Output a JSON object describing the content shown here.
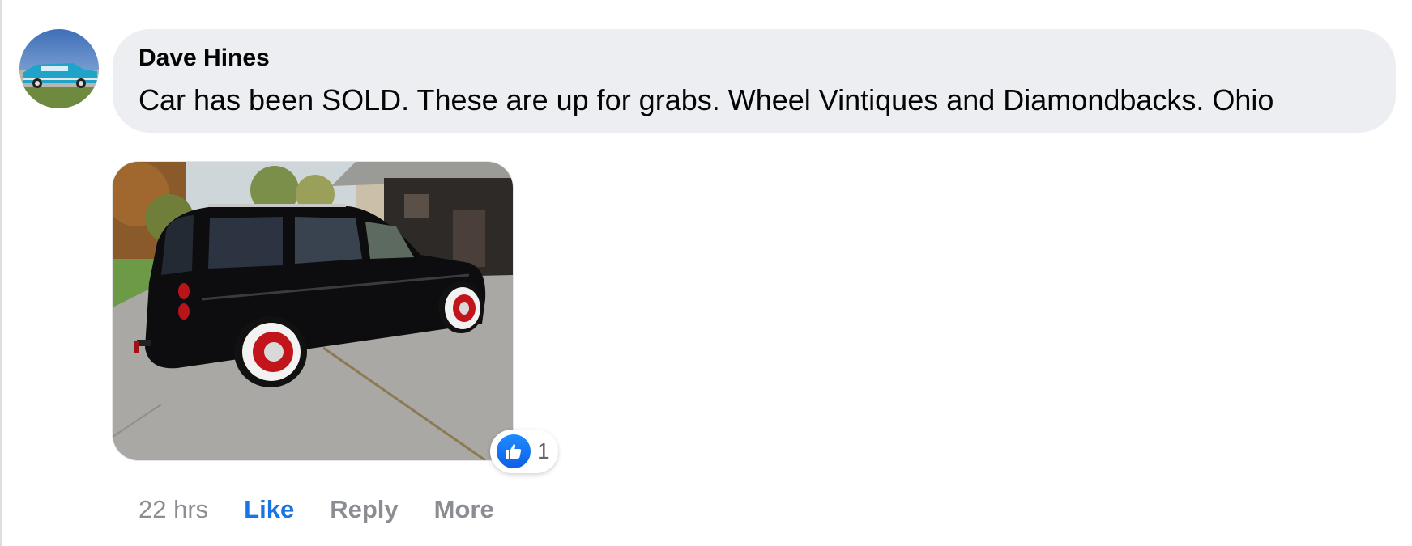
{
  "comment": {
    "author": "Dave Hines",
    "text": "Car has been SOLD. These are up for grabs. Wheel Vintiques and Diamondbacks. Ohio",
    "reactions": {
      "type": "like",
      "count": "1"
    },
    "actions": {
      "timestamp": "22 hrs",
      "like_label": "Like",
      "reply_label": "Reply",
      "more_label": "More"
    }
  },
  "colors": {
    "bubble_bg": "#eceef1",
    "accent_blue": "#1b74e4",
    "muted_text": "#8a8d91",
    "primary_text": "#050505"
  },
  "icons": {
    "like": "thumbs-up-icon"
  }
}
